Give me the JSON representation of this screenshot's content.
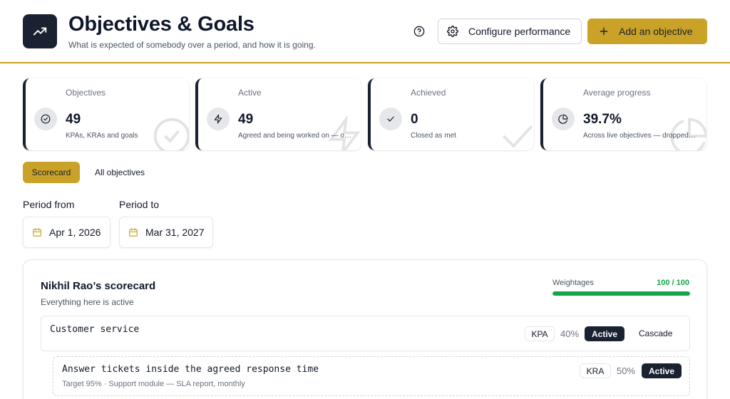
{
  "header": {
    "title": "Objectives & Goals",
    "subtitle": "What is expected of somebody over a period, and how it is going.",
    "help_icon": "help-circle-icon",
    "configure_label": "Configure performance",
    "add_label": "Add an objective",
    "accent_color": "#c9a227",
    "dark_color": "#1a2130"
  },
  "stats": [
    {
      "label": "Objectives",
      "value": "49",
      "sub": "KPAs, KRAs and goals",
      "icon": "check-circle-icon"
    },
    {
      "label": "Active",
      "value": "49",
      "sub": "Agreed and being worked on — ou…",
      "icon": "bolt-icon"
    },
    {
      "label": "Achieved",
      "value": "0",
      "sub": "Closed as met",
      "icon": "check-icon"
    },
    {
      "label": "Average progress",
      "value": "39.7%",
      "sub": "Across live objectives — dropped…",
      "icon": "pie-chart-icon"
    }
  ],
  "tabs": {
    "scorecard": "Scorecard",
    "all": "All objectives"
  },
  "period": {
    "from_label": "Period from",
    "from_value": "Apr 1, 2026",
    "to_label": "Period to",
    "to_value": "Mar 31, 2027"
  },
  "scorecard": {
    "title": "Nikhil Rao’s scorecard",
    "subtitle": "Everything here is active",
    "weightages_label": "Weightages",
    "weightages_value": "100 / 100",
    "weightages_fraction": 1.0,
    "kpa": {
      "name": "Customer service",
      "type": "KPA",
      "weight": "40%",
      "status": "Active",
      "action": "Cascade"
    },
    "kra": {
      "name": "Answer tickets inside the agreed response time",
      "sub": "Target 95% · Support module — SLA report, monthly",
      "type": "KRA",
      "weight": "50%",
      "status": "Active"
    }
  }
}
